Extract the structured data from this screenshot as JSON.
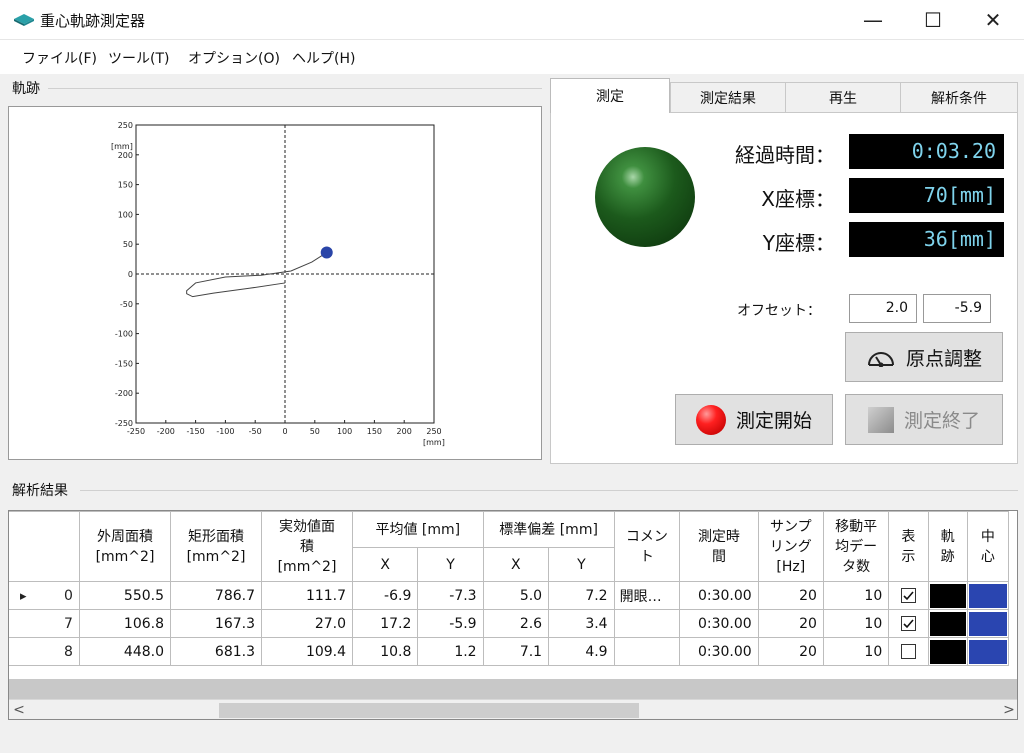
{
  "window": {
    "title": "重心軌跡測定器",
    "minimize": "—",
    "maximize": "☐",
    "close": "✕"
  },
  "menu": [
    {
      "label": "ファイル(F)"
    },
    {
      "label": "ツール(T)"
    },
    {
      "label": "オプション(O)"
    },
    {
      "label": "ヘルプ(H)"
    }
  ],
  "trajectory": {
    "group_label": "軌跡",
    "unit": "[mm]",
    "ticks_x": [
      -250,
      -200,
      -150,
      -100,
      -50,
      0,
      50,
      100,
      150,
      200,
      250
    ],
    "ticks_y": [
      250,
      200,
      150,
      100,
      50,
      0,
      -50,
      -100,
      -150,
      -200,
      -250
    ],
    "range": [
      -250,
      250
    ],
    "path_points": [
      [
        0,
        -15
      ],
      [
        -60,
        -24
      ],
      [
        -120,
        -32
      ],
      [
        -155,
        -38
      ],
      [
        -165,
        -33
      ],
      [
        -165,
        -28
      ],
      [
        -150,
        -15
      ],
      [
        -100,
        -5
      ],
      [
        -40,
        -2
      ],
      [
        10,
        5
      ],
      [
        45,
        20
      ],
      [
        70,
        36
      ]
    ],
    "current": {
      "x": 70,
      "y": 36
    },
    "marker_color": "#2a45a8"
  },
  "tabs": [
    {
      "label": "測定",
      "active": true
    },
    {
      "label": "測定結果",
      "active": false
    },
    {
      "label": "再生",
      "active": false
    },
    {
      "label": "解析条件",
      "active": false
    }
  ],
  "measure": {
    "status_color": "#1c5a1c",
    "elapsed_label": "経過時間：",
    "elapsed_value": "0:03.20",
    "x_label": "X座標：",
    "x_value": "70[mm]",
    "y_label": "Y座標：",
    "y_value": "36[mm]",
    "offset_label": "オフセット：",
    "offset_x": "2.0",
    "offset_y": "-5.9",
    "origin_button": "原点調整",
    "start_button": "測定開始",
    "stop_button": "測定終了"
  },
  "results": {
    "group_label": "解析結果",
    "headers": {
      "outer_area": [
        "外周面積",
        "[mm^2]"
      ],
      "rect_area": [
        "矩形面積",
        "[mm^2]"
      ],
      "eff_area": [
        "実効値面",
        "積",
        "[mm^2]"
      ],
      "mean": "平均値 [mm]",
      "std": "標準偏差 [mm]",
      "x": "X",
      "y": "Y",
      "comment": [
        "コメン",
        "ト"
      ],
      "time": [
        "測定時",
        "間"
      ],
      "sampling": [
        "サンプ",
        "リング",
        "[Hz]"
      ],
      "moving": [
        "移動平",
        "均デー",
        "タ数"
      ],
      "display": [
        "表",
        "示"
      ],
      "track": [
        "軌",
        "跡"
      ],
      "center": [
        "中",
        "心"
      ]
    },
    "rows": [
      {
        "marker": "▸",
        "idx": "0",
        "outer": "550.5",
        "rect": "786.7",
        "eff": "111.7",
        "mx": "-6.9",
        "my": "-7.3",
        "sx": "5.0",
        "sy": "7.2",
        "comment": "開眼…",
        "time": "0:30.00",
        "hz": "20",
        "ma": "10",
        "shown": true,
        "track_color": "#000000",
        "center_color": "#2a45b0"
      },
      {
        "marker": "",
        "idx": "7",
        "outer": "106.8",
        "rect": "167.3",
        "eff": "27.0",
        "mx": "17.2",
        "my": "-5.9",
        "sx": "2.6",
        "sy": "3.4",
        "comment": "",
        "time": "0:30.00",
        "hz": "20",
        "ma": "10",
        "shown": true,
        "track_color": "#000000",
        "center_color": "#2a45b0"
      },
      {
        "marker": "",
        "idx": "8",
        "outer": "448.0",
        "rect": "681.3",
        "eff": "109.4",
        "mx": "10.8",
        "my": "1.2",
        "sx": "7.1",
        "sy": "4.9",
        "comment": "",
        "time": "0:30.00",
        "hz": "20",
        "ma": "10",
        "shown": false,
        "track_color": "#000000",
        "center_color": "#2a45b0"
      }
    ]
  }
}
